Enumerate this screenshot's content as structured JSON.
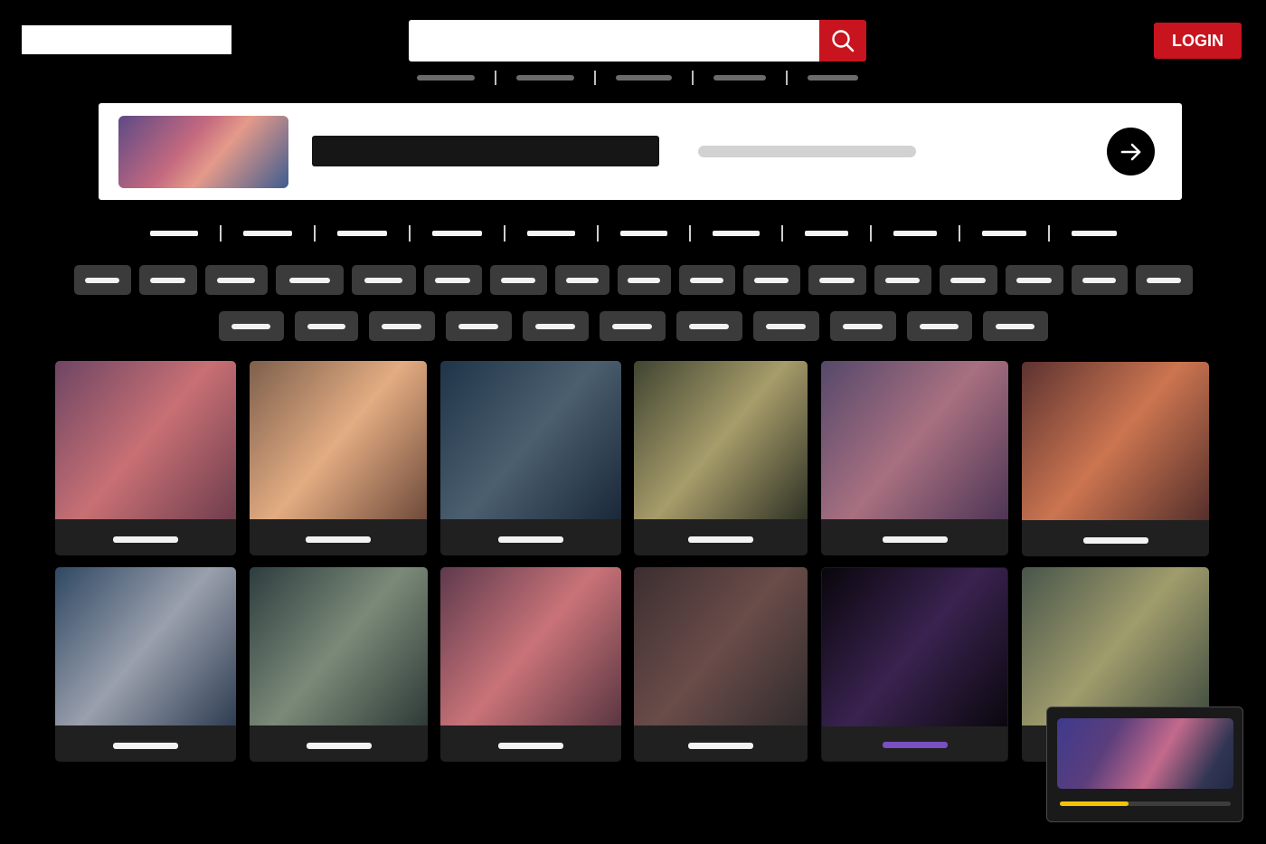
{
  "header": {
    "login_label": "LOGIN",
    "search_placeholder": "",
    "accent_color": "#c8141e"
  },
  "top_nav": {
    "item_count": 5
  },
  "featured_banner": {
    "title": "",
    "subtitle": ""
  },
  "category_nav": {
    "item_count": 11
  },
  "tag_chips": {
    "row1_count": 17,
    "row2_count": 11
  },
  "video_grid": {
    "cards": [
      {
        "caption": "",
        "colors": [
          "#6e4563",
          "#c87074",
          "#6e3d4d"
        ]
      },
      {
        "caption": "",
        "colors": [
          "#7d5f4c",
          "#e3ac82",
          "#6f4b3b"
        ]
      },
      {
        "caption": "",
        "colors": [
          "#1f3448",
          "#4b5f6f",
          "#1a2838"
        ]
      },
      {
        "caption": "",
        "colors": [
          "#3f4431",
          "#a79c6a",
          "#2f3225"
        ]
      },
      {
        "caption": "",
        "colors": [
          "#55486b",
          "#a87080",
          "#4d3555"
        ]
      },
      {
        "caption": "",
        "colors": [
          "#5c3230",
          "#cc7550",
          "#542f2b"
        ]
      },
      {
        "caption": "",
        "colors": [
          "#2f4863",
          "#9aa0ad",
          "#2e3d52"
        ]
      },
      {
        "caption": "",
        "colors": [
          "#2d3d3f",
          "#7b8a78",
          "#2e3a38"
        ]
      },
      {
        "caption": "",
        "colors": [
          "#5e3a4d",
          "#c97378",
          "#5a3642"
        ]
      },
      {
        "caption": "",
        "colors": [
          "#3c2e30",
          "#6a4c49",
          "#2f2b2c"
        ]
      },
      {
        "caption": "",
        "colors": [
          "#09060c",
          "#3a2350",
          "#0a070d"
        ],
        "active": true
      },
      {
        "caption": "",
        "colors": [
          "#47554a",
          "#a09c6c",
          "#3d4a3f"
        ]
      }
    ]
  },
  "mini_player": {
    "progress": 0.4,
    "progress_color": "#f2c400"
  }
}
